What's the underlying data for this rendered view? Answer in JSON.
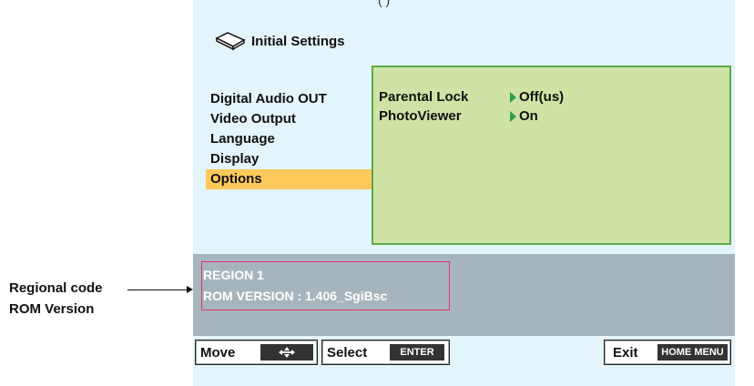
{
  "header": {
    "partial_text": "(                )"
  },
  "title": {
    "text": "Initial Settings",
    "icon": "player-icon"
  },
  "menu": {
    "items": [
      {
        "label": "Digital Audio OUT",
        "selected": false
      },
      {
        "label": "Video Output",
        "selected": false
      },
      {
        "label": "Language",
        "selected": false
      },
      {
        "label": "Display",
        "selected": false
      },
      {
        "label": "Options",
        "selected": true
      }
    ]
  },
  "submenu": {
    "rows": [
      {
        "name": "Parental Lock",
        "value": "Off(us)"
      },
      {
        "name": "PhotoViewer",
        "value": "On"
      }
    ]
  },
  "info": {
    "region": "REGION   1",
    "rom_version": "ROM VERSION : 1.406_SgiBsc"
  },
  "callouts": {
    "regional_code": "Regional code",
    "rom_version": "ROM Version"
  },
  "footer": {
    "move_label": "Move",
    "select_label": "Select",
    "select_key": "ENTER",
    "exit_label": "Exit",
    "exit_key": "HOME MENU"
  },
  "colors": {
    "screen_bg": "#e3f4fb",
    "selected_bg": "#fcc95a",
    "submenu_bg": "#cfe3a5",
    "submenu_border": "#5aab4a",
    "info_bg": "#a6b5bd",
    "highlight_box": "#e0366a"
  }
}
